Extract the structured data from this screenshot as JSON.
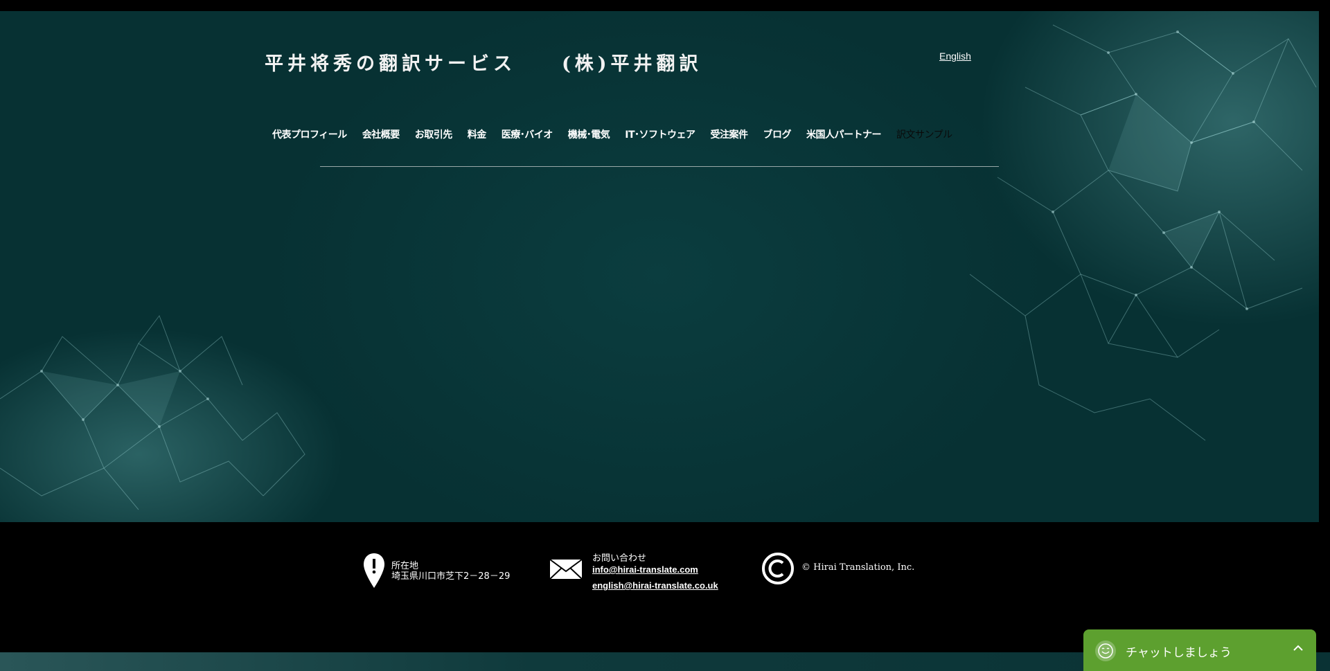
{
  "header": {
    "site_title": "平井将秀の翻訳サービス　　(株)平井翻訳",
    "language_link": "English"
  },
  "nav": {
    "items": [
      {
        "label": "代表プロフィール",
        "active": false
      },
      {
        "label": "会社概要",
        "active": false
      },
      {
        "label": "お取引先",
        "active": false
      },
      {
        "label": "料金",
        "active": false
      },
      {
        "label": "医療･バイオ",
        "active": false
      },
      {
        "label": "機械･電気",
        "active": false
      },
      {
        "label": "IT･ソフトウェア",
        "active": false
      },
      {
        "label": "受注案件",
        "active": false
      },
      {
        "label": "ブログ",
        "active": false
      },
      {
        "label": "米国人パートナー",
        "active": false
      },
      {
        "label": "訳文サンプル",
        "active": true
      }
    ]
  },
  "footer": {
    "address_label": "所在地",
    "address": "埼玉県川口市芝下2－28－29",
    "contact_label": "お問い合わせ",
    "email_primary": "info@hirai-translate.com",
    "email_secondary": "english@hirai-translate.co.uk",
    "copyright": "©  Hirai Translation, Inc."
  },
  "chat": {
    "label": "チャットしましょう"
  },
  "colors": {
    "hero_bg": "#073133",
    "chat_bg": "#5da02f",
    "footer_bg": "#000000"
  },
  "icons": {
    "address": "location-pin-icon",
    "contact": "envelope-icon",
    "copyright": "copyright-icon",
    "chat": "smiley-icon",
    "chat_toggle": "chevron-up-icon"
  }
}
